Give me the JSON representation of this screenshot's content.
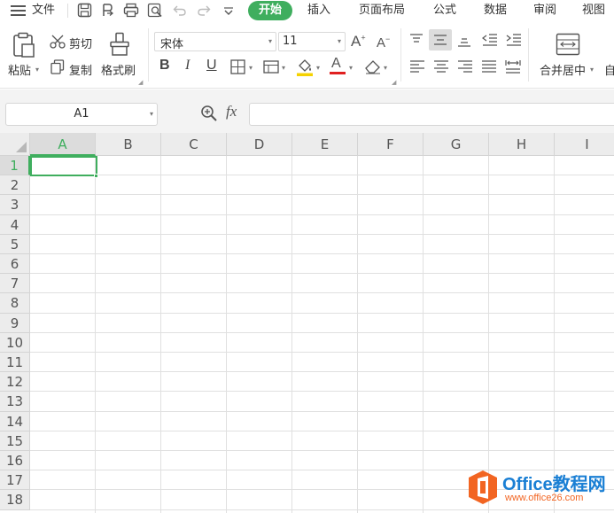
{
  "menubar": {
    "file_label": "文件",
    "tabs": [
      {
        "label": "开始",
        "active": true
      },
      {
        "label": "插入",
        "active": false
      },
      {
        "label": "页面布局",
        "active": false
      },
      {
        "label": "公式",
        "active": false
      },
      {
        "label": "数据",
        "active": false
      },
      {
        "label": "审阅",
        "active": false
      },
      {
        "label": "视图",
        "active": false
      }
    ],
    "accent_color": "#3fae5e"
  },
  "ribbon": {
    "paste_label": "粘贴",
    "cut_label": "剪切",
    "copy_label": "复制",
    "format_painter_label": "格式刷",
    "font_name": "宋体",
    "font_size": "11",
    "merge_center_label": "合并居中",
    "truncated_label": "自",
    "bold_glyph": "B",
    "italic_glyph": "I",
    "underline_glyph": "U",
    "font_color_glyph": "A",
    "font_color": "#e02020",
    "fill_color": "#f5d200",
    "grow_font_glyph": "A",
    "shrink_font_glyph": "A"
  },
  "formula_bar": {
    "name_box": "A1",
    "fx_label": "fx",
    "formula_value": ""
  },
  "grid": {
    "columns": [
      "A",
      "B",
      "C",
      "D",
      "E",
      "F",
      "G",
      "H",
      "I"
    ],
    "rows": [
      "1",
      "2",
      "3",
      "4",
      "5",
      "6",
      "7",
      "8",
      "9",
      "10",
      "11",
      "12",
      "13",
      "14",
      "15",
      "16",
      "17",
      "18"
    ],
    "selected_cell": "A1",
    "grid_color": "#e0e0e0",
    "header_bg": "#ececec"
  },
  "watermark": {
    "title": "Office教程网",
    "url": "www.office26.com",
    "logo_color": "#f26522",
    "text_color": "#1a7fd4"
  }
}
